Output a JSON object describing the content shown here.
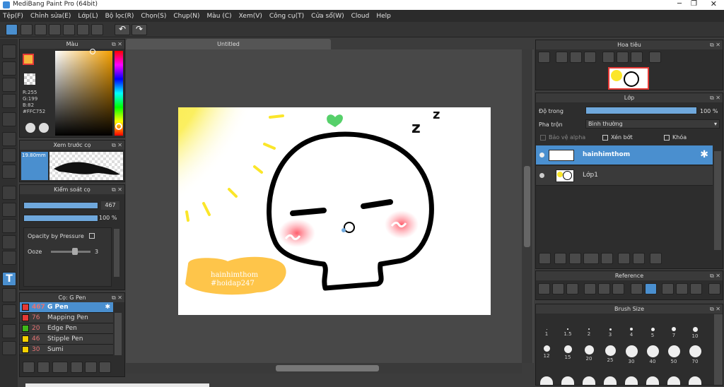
{
  "app_title": "MediBang Paint Pro (64bit)",
  "menu": [
    "Tệp(F)",
    "Chỉnh sửa(E)",
    "Lớp(L)",
    "Bộ lọc(R)",
    "Chọn(S)",
    "Chụp(N)",
    "Màu (C)",
    "Xem(V)",
    "Công cụ(T)",
    "Cửa sổ(W)",
    "Cloud",
    "Help"
  ],
  "color_panel": {
    "title": "Màu",
    "r": "R:255",
    "g": "G:199",
    "b": "B:82",
    "hex": "#FFC752",
    "fg": "#f5b63c",
    "bg": "#ffffff"
  },
  "brush_preview": {
    "title": "Xem trước cọ",
    "size": "19.80mm"
  },
  "brush_control": {
    "title": "Kiểm soát cọ",
    "size_value": "467",
    "opacity_value": "100 %",
    "opacity_pressure": "Opacity by Pressure",
    "ooze_label": "Ooze",
    "ooze_value": "3",
    "size_fraction": 1.0,
    "opacity_fraction": 1.0,
    "ooze_fraction": 0.6
  },
  "brush_list": {
    "title": "Cọ: G Pen",
    "items": [
      {
        "size": "467",
        "name": "G Pen",
        "color": "#e53935",
        "selected": true
      },
      {
        "size": "76",
        "name": "Mapping Pen",
        "color": "#e53935",
        "selected": false
      },
      {
        "size": "20",
        "name": "Edge Pen",
        "color": "#3fb618",
        "selected": false
      },
      {
        "size": "46",
        "name": "Stipple Pen",
        "color": "#f5d000",
        "selected": false
      },
      {
        "size": "30",
        "name": "Sumi",
        "color": "#f5d000",
        "selected": false
      }
    ]
  },
  "canvas": {
    "tab": "Untitled",
    "watermark_line1": "hainhimthom",
    "watermark_line2": "#hoidap247"
  },
  "navigator": {
    "title": "Hoa tiêu"
  },
  "layers": {
    "title": "Lớp",
    "opacity_label": "Độ trong",
    "opacity_value": "100 %",
    "opacity_fraction": 1.0,
    "blend_label": "Pha trộn",
    "blend_value": "Bình thường",
    "protect_alpha": "Bảo vệ alpha",
    "clip": "Xén bớt",
    "lock": "Khóa",
    "items": [
      {
        "name": "hainhimthom",
        "selected": true
      },
      {
        "name": "Lớp1",
        "selected": false
      }
    ]
  },
  "reference": {
    "title": "Reference"
  },
  "brush_size": {
    "title": "Brush Size",
    "row1": [
      "1",
      "1.5",
      "2",
      "3",
      "4",
      "5",
      "7",
      "10"
    ],
    "row2": [
      "12",
      "15",
      "20",
      "25",
      "30",
      "40",
      "50",
      "70"
    ]
  },
  "colors": {
    "accent": "#4a8fcf",
    "selected_row": "#4a8fcf"
  }
}
